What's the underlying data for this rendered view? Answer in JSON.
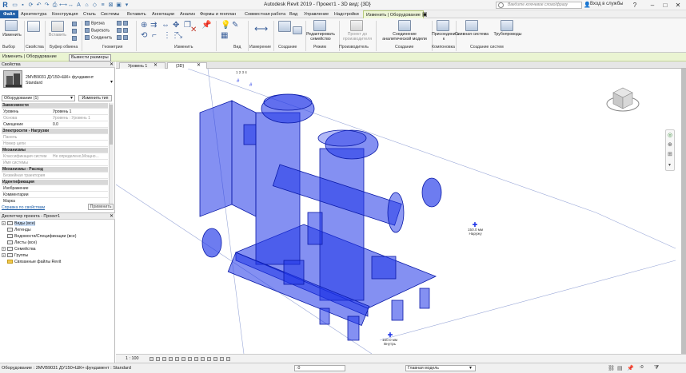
{
  "window": {
    "title": "Autodesk Revit 2019 - Проект1 - 3D вид: {3D}",
    "search_placeholder": "Введите ключевое слово/фразу",
    "signin": "Вход в службы"
  },
  "ribbon_tabs": [
    "Файл",
    "Архитектура",
    "Конструкция",
    "Сталь",
    "Системы",
    "Вставить",
    "Аннотации",
    "Анализ",
    "Формы и генплан",
    "Совместная работа",
    "Вид",
    "Управление",
    "Надстройки",
    "Изменить | Оборудование"
  ],
  "ribbon": {
    "modify_label": "Изменить",
    "select_panel": "Выбор",
    "paste_label": "Вставить",
    "props_panel": "Свойства",
    "clipboard_panel": "Буфер обмена",
    "cut_label": "Врезка",
    "cut2_label": "Вырезать",
    "join_label": "Соединить",
    "geometry_panel": "Геометрия",
    "modify_panel": "Изменить",
    "view_panel": "Вид",
    "measure_panel": "Измерение",
    "create_panel": "Создание",
    "edit_family_label": "Редактировать семейство",
    "mode_panel": "Режим",
    "project_to_label": "Проект до производителя",
    "manufacturer_panel": "Производитель",
    "connect_model_label": "Соединение аналитической модели",
    "create_panel2": "Создание",
    "attach_label": "Присоединить к",
    "layout_panel": "Компоновка",
    "pipe_system_label": "Сливная система",
    "piping_label": "Трубопроводы",
    "create_systems_panel": "Создание систем"
  },
  "context_bar": {
    "label": "Изменить | Оборудование",
    "button": "Вывести размеры"
  },
  "properties": {
    "header": "Свойства",
    "type_name_line1": "2MVB9031 ДУ150+ШК+ фундамент",
    "type_name_line2": "Standard",
    "type_select": "Оборудование (1)",
    "edit_type": "Изменить тип",
    "rows": [
      {
        "k": "Зависимости",
        "group": true
      },
      {
        "k": "Уровень",
        "v": "Уровень 1"
      },
      {
        "k": "Основа",
        "v": "Уровень : Уровень 1",
        "grey": true
      },
      {
        "k": "Смещение",
        "v": "0.0"
      },
      {
        "k": "Электросети - Нагрузки",
        "group": true
      },
      {
        "k": "Панель",
        "v": "",
        "grey": true
      },
      {
        "k": "Номер цепи",
        "v": "",
        "grey": true
      },
      {
        "k": "Механизмы",
        "group": true
      },
      {
        "k": "Классификация систем",
        "v": "Не определено,Мощно...",
        "grey": true
      },
      {
        "k": "Имя системы",
        "v": "",
        "grey": true
      },
      {
        "k": "Механизмы - Расход",
        "group": true
      },
      {
        "k": "Безвейная траектория",
        "v": "",
        "grey": true
      },
      {
        "k": "Идентификация",
        "group": true
      },
      {
        "k": "Изображение",
        "v": ""
      },
      {
        "k": "Комментарии",
        "v": ""
      },
      {
        "k": "Марка",
        "v": ""
      }
    ],
    "help_link": "Справка по свойствам",
    "apply": "Применить"
  },
  "browser": {
    "header": "Диспетчер проекта - Проект1",
    "items": [
      {
        "label": "Виды (все)",
        "expander": "+",
        "selected": true
      },
      {
        "label": "Легенды",
        "expander": ""
      },
      {
        "label": "Ведомости/Спецификации (все)",
        "expander": ""
      },
      {
        "label": "Листы (все)",
        "expander": ""
      },
      {
        "label": "Семейства",
        "expander": "+"
      },
      {
        "label": "Группы",
        "expander": "+"
      },
      {
        "label": "Связанные файлы Revit",
        "expander": ""
      }
    ]
  },
  "view_tabs": [
    "Уровень 1",
    "{3D}"
  ],
  "canvas": {
    "annotation_top": "1 2 3 4",
    "tag_right_value": "150.0 мм",
    "tag_right_label": "Наружу",
    "tag_bottom_value": "150.0 мм",
    "tag_bottom_label": "Внутрь"
  },
  "viewbar": {
    "scale": "1 : 100"
  },
  "status": {
    "text": "Оборудование : 2MVB9031 ДУ150+ШК+ фундамент : Standard",
    "zero": ":0",
    "model": "Главная модель",
    "filter": ":0"
  },
  "colors": {
    "pump_blue": "#1f35e8",
    "file_tab": "#1f5fa8",
    "context_green": "#eaf4d2"
  }
}
